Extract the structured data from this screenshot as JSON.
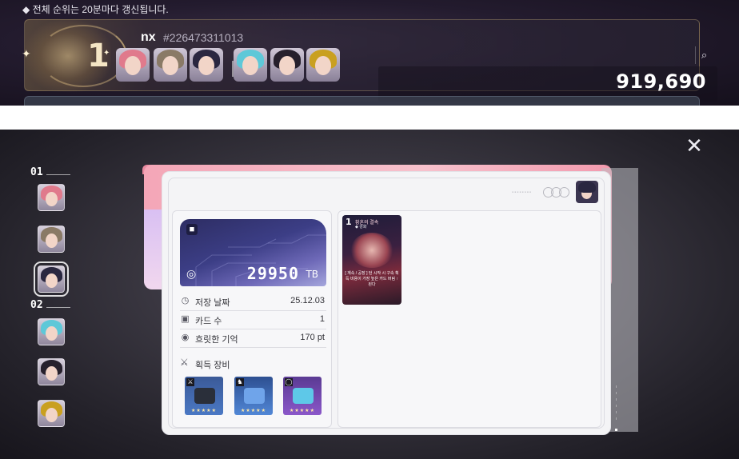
{
  "ranking": {
    "notice": "◆ 전체 순위는 20분마다 갱신됩니다.",
    "entry": {
      "rank": "1",
      "player_name": "nx",
      "player_id": "#226473311013",
      "score": "919,690",
      "team_avatars": [
        {
          "name": "pink-haired",
          "hair": "#e07a8c"
        },
        {
          "name": "brown-haired",
          "hair": "#8a7a66"
        },
        {
          "name": "dark-haired",
          "hair": "#2a2740"
        },
        {
          "name": "cyan-haired",
          "hair": "#5ec8d8"
        },
        {
          "name": "black-haired",
          "hair": "#26202c"
        },
        {
          "name": "masked",
          "hair": "#c9a020"
        }
      ]
    }
  },
  "detail": {
    "save_card": {
      "value": "29950",
      "unit": "TB"
    },
    "stats": [
      {
        "icon": "clock-icon",
        "glyph": "◷",
        "label": "저장 날짜",
        "value": "25.12.03"
      },
      {
        "icon": "card-icon",
        "glyph": "▣",
        "label": "카드 수",
        "value": "1"
      },
      {
        "icon": "memory-icon",
        "glyph": "◉",
        "label": "흐릿한 기억",
        "value": "170 pt"
      }
    ],
    "equipment": {
      "title": "획득 장비",
      "items": [
        {
          "slot": "weapon",
          "slot_glyph": "⚔",
          "color_top": "#3b5a98",
          "color_bottom": "#4a78c4",
          "body": "#2a2f3a",
          "stars": "★★★★★"
        },
        {
          "slot": "armor",
          "slot_glyph": "♞",
          "color_top": "#2d4f91",
          "color_bottom": "#5187d6",
          "body": "#6fa4ea",
          "stars": "★★★★★"
        },
        {
          "slot": "accessory",
          "slot_glyph": "◯",
          "color_top": "#5a3a93",
          "color_bottom": "#8a57c9",
          "body": "#5ec8e8",
          "stars": "★★★★★"
        }
      ]
    },
    "memory_card": {
      "number": "1",
      "title": "황혼의 결속",
      "sub": "◆ 강화",
      "desc": "[ 계속 / 공장 ] 턴 시작 시 구속 획득 비용이 가장 높은 카드 버림 ↑된다"
    },
    "roster": {
      "group1_label": "01",
      "group2_label": "02",
      "avatars": [
        {
          "name": "pink-haired",
          "hair": "#e07a8c"
        },
        {
          "name": "brown-haired",
          "hair": "#8a7a66"
        },
        {
          "name": "dark-haired",
          "hair": "#2a2740"
        },
        {
          "name": "cyan-haired",
          "hair": "#5ec8d8"
        },
        {
          "name": "black-haired",
          "hair": "#26202c"
        },
        {
          "name": "masked",
          "hair": "#c9a020"
        }
      ]
    }
  },
  "icons": {
    "search": "⌕",
    "close": "✕",
    "lock": "🔒",
    "swirl": "◌"
  }
}
